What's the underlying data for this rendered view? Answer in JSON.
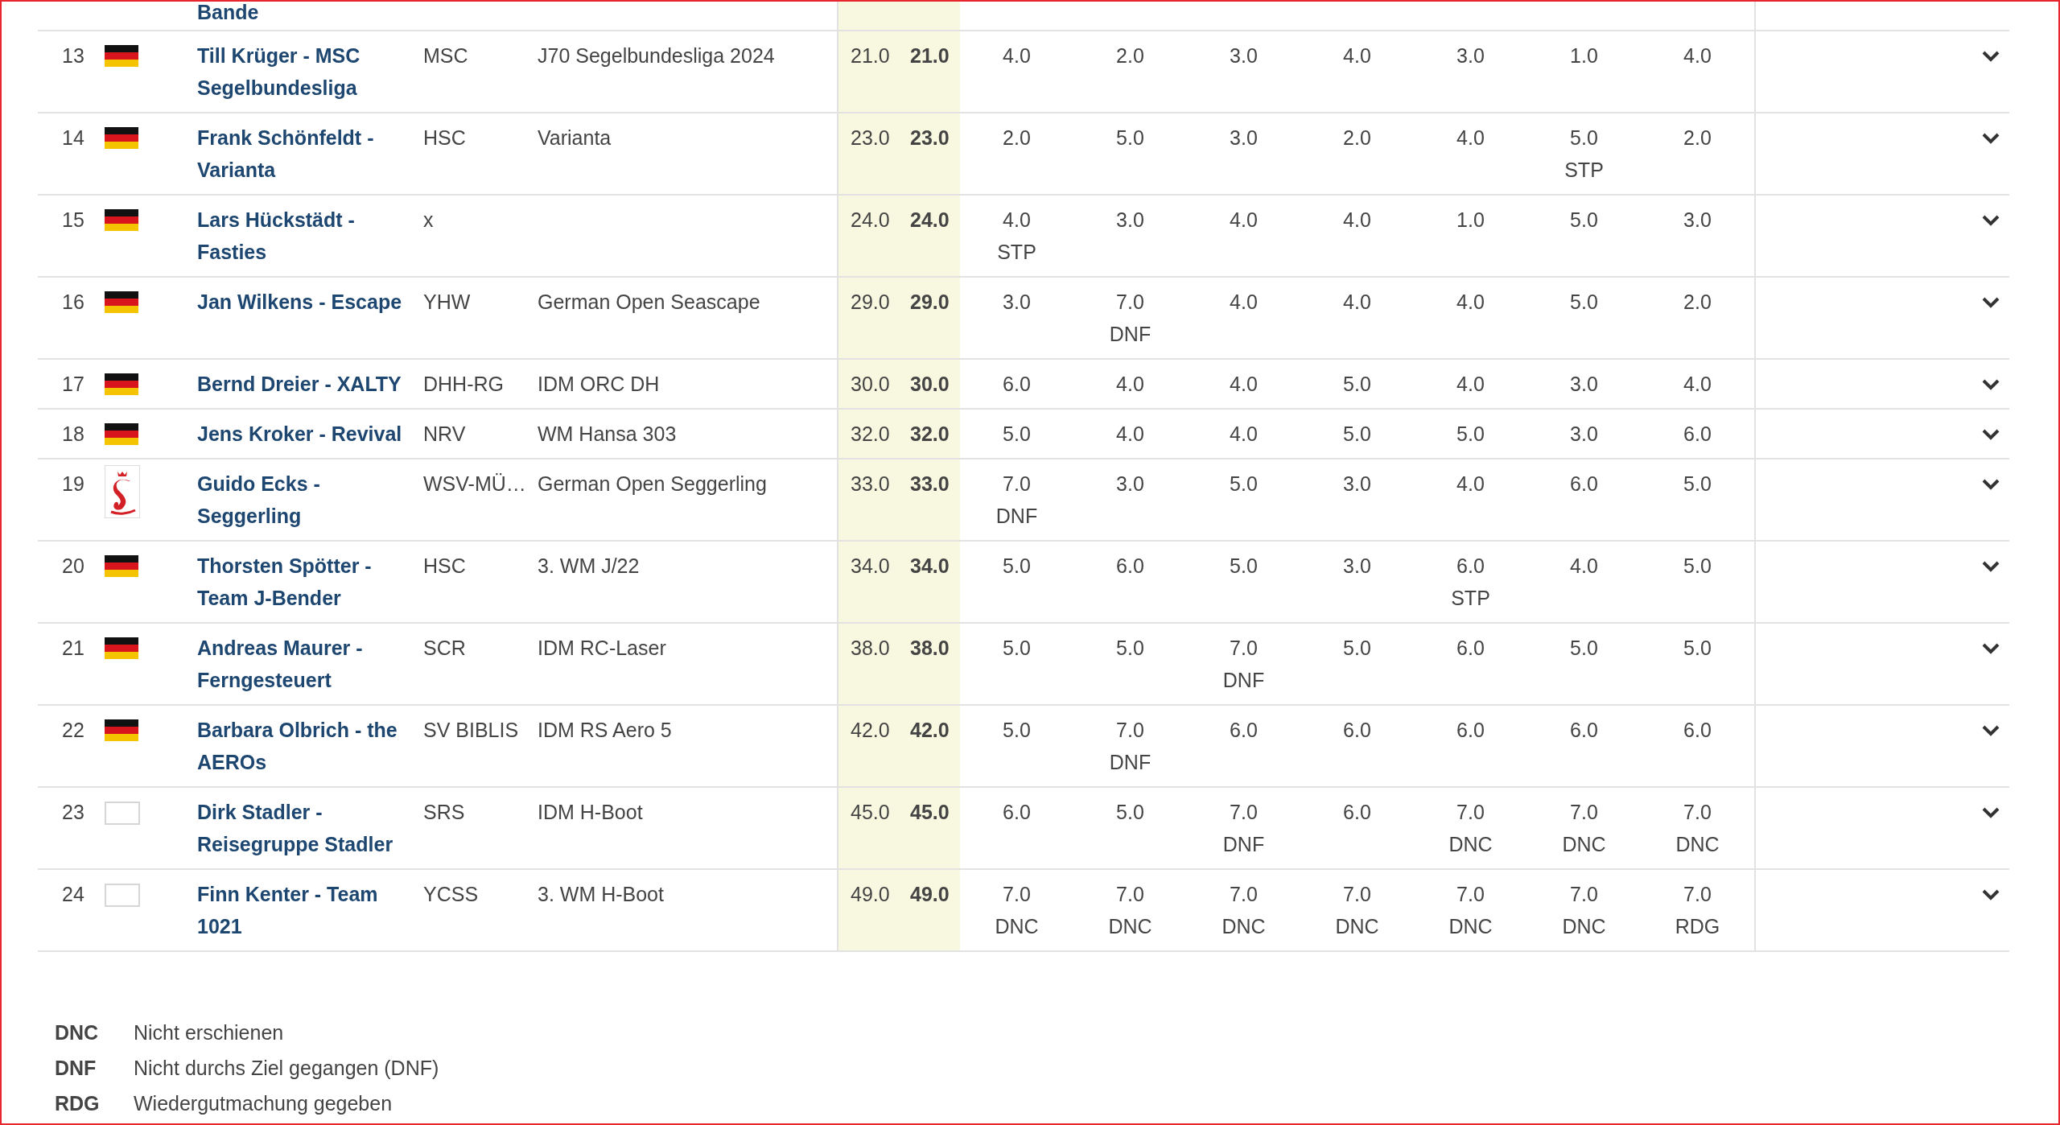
{
  "top_fragment": {
    "name": "Bande"
  },
  "rows": [
    {
      "rank": "13",
      "flag": {
        "kind": "germany"
      },
      "name": "Till Krüger - MSC Segelbundesliga",
      "club": "MSC",
      "boat": "J70 Segelbundesliga 2024",
      "total": "21.0",
      "net": "21.0",
      "races": [
        {
          "score": "4.0"
        },
        {
          "score": "2.0"
        },
        {
          "score": "3.0"
        },
        {
          "score": "4.0"
        },
        {
          "score": "3.0"
        },
        {
          "score": "1.0"
        },
        {
          "score": "4.0"
        }
      ]
    },
    {
      "rank": "14",
      "flag": {
        "kind": "germany"
      },
      "name": "Frank Schönfeldt - Varianta",
      "club": "HSC",
      "boat": "Varianta",
      "total": "23.0",
      "net": "23.0",
      "races": [
        {
          "score": "2.0"
        },
        {
          "score": "5.0"
        },
        {
          "score": "3.0"
        },
        {
          "score": "2.0"
        },
        {
          "score": "4.0"
        },
        {
          "score": "5.0",
          "code": "STP"
        },
        {
          "score": "2.0"
        }
      ]
    },
    {
      "rank": "15",
      "flag": {
        "kind": "germany"
      },
      "name": "Lars Hückstädt - Fasties",
      "club": "x",
      "total": "24.0",
      "net": "24.0",
      "races": [
        {
          "score": "4.0",
          "code": "STP"
        },
        {
          "score": "3.0"
        },
        {
          "score": "4.0"
        },
        {
          "score": "4.0"
        },
        {
          "score": "1.0"
        },
        {
          "score": "5.0"
        },
        {
          "score": "3.0"
        }
      ]
    },
    {
      "rank": "16",
      "flag": {
        "kind": "germany"
      },
      "name": "Jan Wilkens - Escape",
      "club": "YHW",
      "boat": "German Open Seascape",
      "total": "29.0",
      "net": "29.0",
      "races": [
        {
          "score": "3.0"
        },
        {
          "score": "7.0",
          "code": "DNF"
        },
        {
          "score": "4.0"
        },
        {
          "score": "4.0"
        },
        {
          "score": "4.0"
        },
        {
          "score": "5.0"
        },
        {
          "score": "2.0"
        }
      ]
    },
    {
      "rank": "17",
      "flag": {
        "kind": "germany"
      },
      "name": "Bernd Dreier - XALTY",
      "club": "DHH-RG",
      "boat": "IDM ORC DH",
      "total": "30.0",
      "net": "30.0",
      "races": [
        {
          "score": "6.0"
        },
        {
          "score": "4.0"
        },
        {
          "score": "4.0"
        },
        {
          "score": "5.0"
        },
        {
          "score": "4.0"
        },
        {
          "score": "3.0"
        },
        {
          "score": "4.0"
        }
      ]
    },
    {
      "rank": "18",
      "flag": {
        "kind": "germany"
      },
      "name": "Jens Kroker - Revival",
      "club": "NRV",
      "boat": "WM Hansa 303",
      "total": "32.0",
      "net": "32.0",
      "races": [
        {
          "score": "5.0"
        },
        {
          "score": "4.0"
        },
        {
          "score": "4.0"
        },
        {
          "score": "5.0"
        },
        {
          "score": "5.0"
        },
        {
          "score": "3.0"
        },
        {
          "score": "6.0"
        }
      ]
    },
    {
      "rank": "19",
      "flag": {
        "kind": "club-logo"
      },
      "name": "Guido Ecks - Seggerling",
      "club": "WSV-MÜ…",
      "boat": "German Open Seggerling",
      "total": "33.0",
      "net": "33.0",
      "races": [
        {
          "score": "7.0",
          "code": "DNF"
        },
        {
          "score": "3.0"
        },
        {
          "score": "5.0"
        },
        {
          "score": "3.0"
        },
        {
          "score": "4.0"
        },
        {
          "score": "6.0"
        },
        {
          "score": "5.0"
        }
      ]
    },
    {
      "rank": "20",
      "flag": {
        "kind": "germany"
      },
      "name": "Thorsten Spötter - Team J-Bender",
      "club": "HSC",
      "boat": "3. WM J/22",
      "total": "34.0",
      "net": "34.0",
      "races": [
        {
          "score": "5.0"
        },
        {
          "score": "6.0"
        },
        {
          "score": "5.0"
        },
        {
          "score": "3.0"
        },
        {
          "score": "6.0",
          "code": "STP"
        },
        {
          "score": "4.0"
        },
        {
          "score": "5.0"
        }
      ]
    },
    {
      "rank": "21",
      "flag": {
        "kind": "germany"
      },
      "name": "Andreas Maurer - Ferngesteuert",
      "club": "SCR",
      "boat": "IDM RC-Laser",
      "total": "38.0",
      "net": "38.0",
      "races": [
        {
          "score": "5.0"
        },
        {
          "score": "5.0"
        },
        {
          "score": "7.0",
          "code": "DNF"
        },
        {
          "score": "5.0"
        },
        {
          "score": "6.0"
        },
        {
          "score": "5.0"
        },
        {
          "score": "5.0"
        }
      ]
    },
    {
      "rank": "22",
      "flag": {
        "kind": "germany"
      },
      "name": "Barbara Olbrich - the AEROs",
      "club": "SV BIBLIS",
      "boat": "IDM RS Aero 5",
      "total": "42.0",
      "net": "42.0",
      "races": [
        {
          "score": "5.0"
        },
        {
          "score": "7.0",
          "code": "DNF"
        },
        {
          "score": "6.0"
        },
        {
          "score": "6.0"
        },
        {
          "score": "6.0"
        },
        {
          "score": "6.0"
        },
        {
          "score": "6.0"
        }
      ]
    },
    {
      "rank": "23",
      "flag": {
        "kind": "empty"
      },
      "name": "Dirk Stadler - Reisegruppe Stadler",
      "club": "SRS",
      "boat": "IDM H-Boot",
      "total": "45.0",
      "net": "45.0",
      "races": [
        {
          "score": "6.0"
        },
        {
          "score": "5.0"
        },
        {
          "score": "7.0",
          "code": "DNF"
        },
        {
          "score": "6.0"
        },
        {
          "score": "7.0",
          "code": "DNC"
        },
        {
          "score": "7.0",
          "code": "DNC"
        },
        {
          "score": "7.0",
          "code": "DNC"
        }
      ]
    },
    {
      "rank": "24",
      "flag": {
        "kind": "empty"
      },
      "name": "Finn Kenter - Team 1021",
      "club": "YCSS",
      "boat": "3. WM H-Boot",
      "total": "49.0",
      "net": "49.0",
      "races": [
        {
          "score": "7.0",
          "code": "DNC"
        },
        {
          "score": "7.0",
          "code": "DNC"
        },
        {
          "score": "7.0",
          "code": "DNC"
        },
        {
          "score": "7.0",
          "code": "DNC"
        },
        {
          "score": "7.0",
          "code": "DNC"
        },
        {
          "score": "7.0",
          "code": "DNC"
        },
        {
          "score": "7.0",
          "code": "RDG"
        }
      ]
    }
  ],
  "legend": [
    {
      "code": "DNC",
      "text": "Nicht erschienen"
    },
    {
      "code": "DNF",
      "text": "Nicht durchs Ziel gegangen (DNF)"
    },
    {
      "code": "RDG",
      "text": "Wiedergutmachung gegeben"
    }
  ]
}
